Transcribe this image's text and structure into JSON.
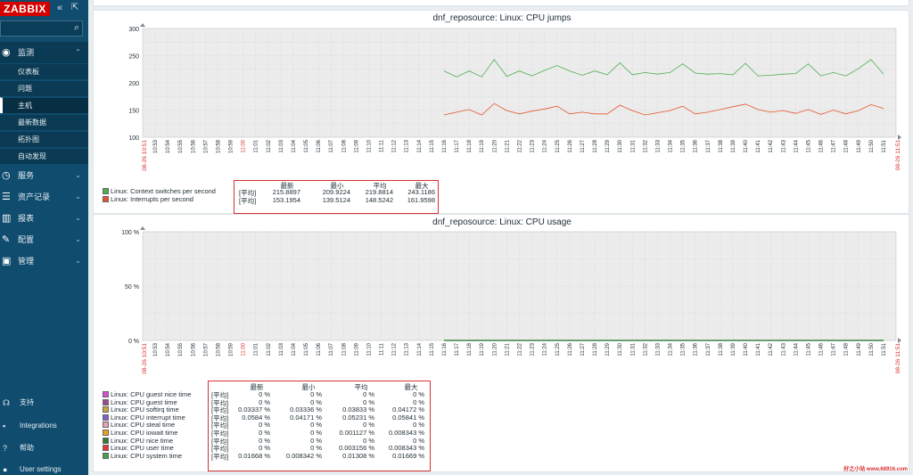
{
  "sidebar": {
    "logo": "ZABBIX",
    "collapse_icon": "«",
    "kiosk_icon": "⇱",
    "search_icon": "⌕",
    "menu": [
      {
        "label": "监测",
        "icon": "eye-icon",
        "glyph": "◉",
        "arrow": "⌃"
      },
      {
        "label": "服务",
        "icon": "clock-icon",
        "glyph": "◷",
        "arrow": "⌄"
      },
      {
        "label": "资产记录",
        "icon": "list-icon",
        "glyph": "☰",
        "arrow": "⌄"
      },
      {
        "label": "报表",
        "icon": "chart-icon",
        "glyph": "▥",
        "arrow": "⌄"
      },
      {
        "label": "配置",
        "icon": "wrench-icon",
        "glyph": "✎",
        "arrow": "⌄"
      },
      {
        "label": "管理",
        "icon": "gear-icon",
        "glyph": "▣",
        "arrow": "⌄"
      }
    ],
    "submenu": [
      "仪表板",
      "问题",
      "主机",
      "最新数据",
      "拓扑图",
      "自动发现"
    ],
    "bottom": [
      {
        "label": "支持",
        "icon": "support-icon",
        "glyph": "☊"
      },
      {
        "label": "Integrations",
        "icon": "integrations-icon",
        "glyph": "▪"
      },
      {
        "label": "帮助",
        "icon": "help-icon",
        "glyph": "?"
      },
      {
        "label": "User settings",
        "icon": "user-icon",
        "glyph": "●"
      }
    ]
  },
  "time_axis": {
    "start_label": "08-26 10:51",
    "end_label": "08-26 11:51",
    "ticks": [
      "10:53",
      "10:54",
      "10:55",
      "10:56",
      "10:57",
      "10:58",
      "10:59",
      "11:00",
      "11:01",
      "11:02",
      "11:03",
      "11:04",
      "11:05",
      "11:06",
      "11:07",
      "11:08",
      "11:09",
      "11:10",
      "11:11",
      "11:12",
      "11:13",
      "11:14",
      "11:15",
      "11:16",
      "11:17",
      "11:18",
      "11:19",
      "11:20",
      "11:21",
      "11:22",
      "11:23",
      "11:24",
      "11:25",
      "11:26",
      "11:27",
      "11:28",
      "11:29",
      "11:30",
      "11:31",
      "11:32",
      "11:33",
      "11:34",
      "11:35",
      "11:36",
      "11:37",
      "11:38",
      "11:39",
      "11:40",
      "11:41",
      "11:42",
      "11:43",
      "11:44",
      "11:45",
      "11:46",
      "11:47",
      "11:48",
      "11:49",
      "11:50",
      "11:51"
    ],
    "highlight_tick": "11:00"
  },
  "graph1": {
    "title": "dnf_reposource: Linux: CPU jumps",
    "y_ticks": [
      "300",
      "250",
      "200",
      "150",
      "100"
    ],
    "stats_headers": [
      "最新",
      "最小",
      "平均",
      "最大"
    ],
    "legend": [
      {
        "name": "Linux: Context switches per second",
        "color": "#4caf50",
        "tag": "[平均]",
        "values": [
          "215.8897",
          "209.9224",
          "219.8814",
          "243.1186"
        ]
      },
      {
        "name": "Linux: Interrupts per second",
        "color": "#e5552c",
        "tag": "[平均]",
        "values": [
          "153.1954",
          "139.5124",
          "148.5242",
          "161.9598"
        ]
      }
    ]
  },
  "graph2": {
    "title": "dnf_reposource: Linux: CPU usage",
    "y_ticks": [
      "100 %",
      "50 %",
      "0 %"
    ],
    "stats_headers": [
      "最新",
      "最小",
      "平均",
      "最大"
    ],
    "legend": [
      {
        "name": "Linux: CPU guest nice time",
        "color": "#d64fd6",
        "tag": "[平均]",
        "values": [
          "0 %",
          "0 %",
          "0 %",
          "0 %"
        ]
      },
      {
        "name": "Linux: CPU guest time",
        "color": "#9c4a8e",
        "tag": "[平均]",
        "values": [
          "0 %",
          "0 %",
          "0 %",
          "0 %"
        ]
      },
      {
        "name": "Linux: CPU softirq time",
        "color": "#c9a238",
        "tag": "[平均]",
        "values": [
          "0.03337 %",
          "0.03336 %",
          "0.03833 %",
          "0.04172 %"
        ]
      },
      {
        "name": "Linux: CPU interrupt time",
        "color": "#7d5fc9",
        "tag": "[平均]",
        "values": [
          "0.0584 %",
          "0.04171 %",
          "0.05231 %",
          "0.05841 %"
        ]
      },
      {
        "name": "Linux: CPU steal time",
        "color": "#e8a0b8",
        "tag": "[平均]",
        "values": [
          "0 %",
          "0 %",
          "0 %",
          "0 %"
        ]
      },
      {
        "name": "Linux: CPU iowait time",
        "color": "#e6a11f",
        "tag": "[平均]",
        "values": [
          "0 %",
          "0 %",
          "0.001127 %",
          "0.008343 %"
        ]
      },
      {
        "name": "Linux: CPU nice time",
        "color": "#2e7d32",
        "tag": "[平均]",
        "values": [
          "0 %",
          "0 %",
          "0 %",
          "0 %"
        ]
      },
      {
        "name": "Linux: CPU user time",
        "color": "#e53935",
        "tag": "[平均]",
        "values": [
          "0 %",
          "0 %",
          "0.003156 %",
          "0.008343 %"
        ]
      },
      {
        "name": "Linux: CPU system time",
        "color": "#43a047",
        "tag": "[平均]",
        "values": [
          "0.01668 %",
          "0.008342 %",
          "0.01308 %",
          "0.01669 %"
        ]
      }
    ]
  },
  "chart_data": [
    {
      "type": "line",
      "title": "dnf_reposource: Linux: CPU jumps",
      "ylim": [
        100,
        300
      ],
      "x": [
        "11:16",
        "11:17",
        "11:18",
        "11:19",
        "11:20",
        "11:21",
        "11:22",
        "11:23",
        "11:24",
        "11:25",
        "11:26",
        "11:27",
        "11:28",
        "11:29",
        "11:30",
        "11:31",
        "11:32",
        "11:33",
        "11:34",
        "11:35",
        "11:36",
        "11:37",
        "11:38",
        "11:39",
        "11:40",
        "11:41",
        "11:42",
        "11:43",
        "11:44",
        "11:45",
        "11:46",
        "11:47",
        "11:48",
        "11:49",
        "11:50",
        "11:51"
      ],
      "series": [
        {
          "name": "Linux: Context switches per second",
          "values": [
            222,
            211,
            222,
            211,
            243,
            212,
            222,
            213,
            223,
            232,
            222,
            214,
            222,
            215,
            237,
            215,
            219,
            216,
            219,
            235,
            218,
            216,
            217,
            215,
            236,
            213,
            214,
            216,
            217,
            235,
            213,
            219,
            213,
            226,
            243,
            216
          ]
        },
        {
          "name": "Linux: Interrupts per second",
          "values": [
            141,
            146,
            151,
            141,
            162,
            149,
            143,
            148,
            152,
            157,
            143,
            146,
            143,
            143,
            159,
            149,
            141,
            145,
            149,
            157,
            143,
            146,
            151,
            156,
            161,
            151,
            146,
            149,
            144,
            151,
            142,
            150,
            143,
            149,
            160,
            153
          ]
        }
      ],
      "grid": true,
      "legend": "bottom-left"
    },
    {
      "type": "line",
      "title": "dnf_reposource: Linux: CPU usage",
      "ylim": [
        0,
        100
      ],
      "x": [
        "11:16",
        "11:51"
      ],
      "series": [
        {
          "name": "Linux: CPU guest nice time",
          "values": [
            0,
            0
          ]
        },
        {
          "name": "Linux: CPU system time",
          "values": [
            0.01668,
            0.01669
          ]
        }
      ],
      "grid": true,
      "legend": "bottom-left"
    }
  ],
  "watermark": "好之小站 www.68916.com"
}
